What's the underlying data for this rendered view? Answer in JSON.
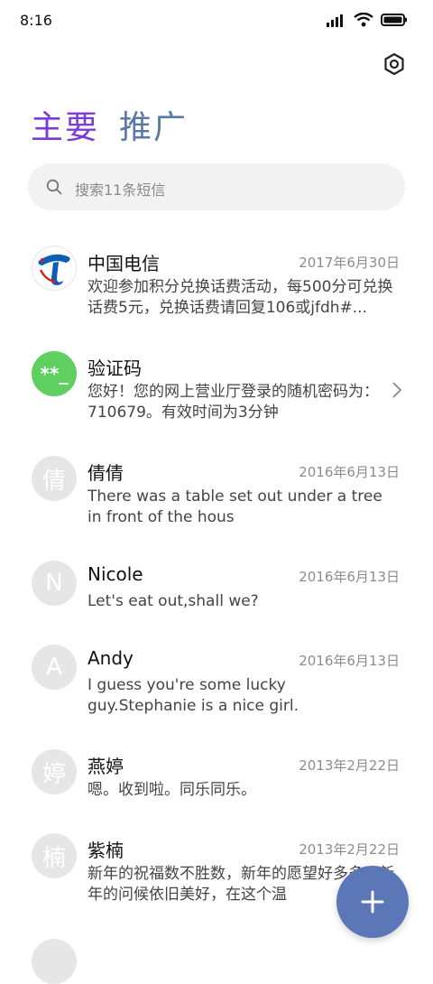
{
  "status_bar": {
    "time": "8:16"
  },
  "tabs": [
    {
      "label": "主要",
      "active": true
    },
    {
      "label": "推广",
      "active": false
    }
  ],
  "search": {
    "placeholder": "搜索11条短信"
  },
  "conversations": [
    {
      "name": "中国电信",
      "date": "2017年6月30日",
      "preview": "欢迎参加积分兑换话费活动，每500分可兑换话费5元，兑换话费请回复106或jfdh#...",
      "avatar": "telecom-logo"
    },
    {
      "name": "验证码",
      "date": "",
      "preview": "您好！您的网上营业厅登录的随机密码为：710679。有效时间为3分钟",
      "avatar_text": "**_"
    },
    {
      "name": "倩倩",
      "date": "2016年6月13日",
      "preview": "There was a table set out under a tree in front of the hous",
      "avatar_text": "倩"
    },
    {
      "name": "Nicole",
      "date": "2016年6月13日",
      "preview": "Let's eat out,shall we?",
      "avatar_text": "N"
    },
    {
      "name": "Andy",
      "date": "2016年6月13日",
      "preview": "I guess you're some lucky guy.Stephanie is a nice girl.",
      "avatar_text": "A"
    },
    {
      "name": "燕婷",
      "date": "2013年2月22日",
      "preview": "嗯。收到啦。同乐同乐。",
      "avatar_text": "婷"
    },
    {
      "name": "紫楠",
      "date": "2013年2月22日",
      "preview": "新年的祝福数不胜数，新年的愿望好多多，新年的问候依旧美好，在这个温",
      "avatar_text": "楠"
    }
  ],
  "colors": {
    "active_tab": "#7a3bd6",
    "inactive_tab": "#5a78a6",
    "fab": "#5b77b8",
    "code_avatar": "#5fcf5f"
  },
  "icons": [
    "signal-icon",
    "wifi-icon",
    "battery-icon",
    "settings-icon",
    "search-icon",
    "chevron-right-icon",
    "plus-icon"
  ]
}
